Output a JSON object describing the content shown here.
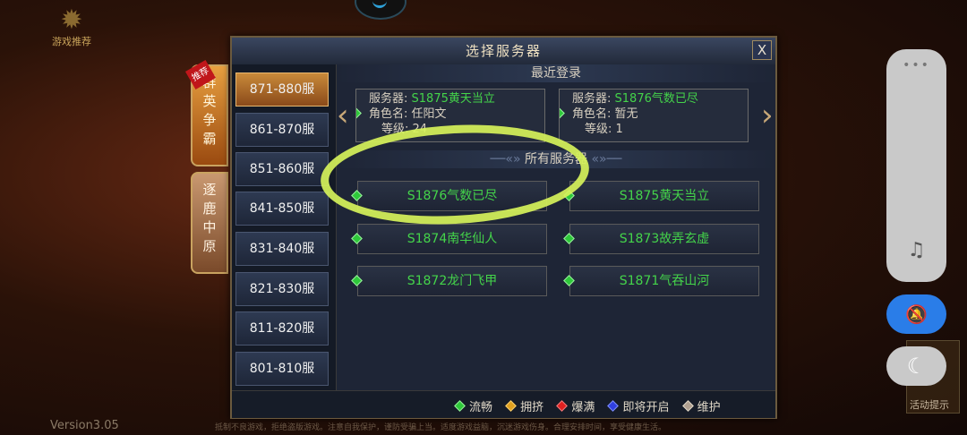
{
  "app": {
    "logo_text": "游戏推荐",
    "version": "Version3.05",
    "bottom_tip": "抵制不良游戏，拒绝盗版游戏。注意自我保护，谨防受骗上当。适度游戏益脑，沉迷游戏伤身。合理安排时间，享受健康生活。"
  },
  "dialog": {
    "title": "选择服务器",
    "close_label": "X",
    "recent_title": "最近登录",
    "all_title": "所有服务器"
  },
  "tabs": [
    {
      "label": "群英争霸",
      "badge": "推荐",
      "active": true
    },
    {
      "label": "逐鹿中原",
      "active": false
    }
  ],
  "ranges": [
    {
      "label": "871-880服",
      "active": true
    },
    {
      "label": "861-870服"
    },
    {
      "label": "851-860服"
    },
    {
      "label": "841-850服"
    },
    {
      "label": "831-840服"
    },
    {
      "label": "821-830服"
    },
    {
      "label": "811-820服"
    },
    {
      "label": "801-810服"
    }
  ],
  "recent": [
    {
      "server_label": "服务器:",
      "server": "S1875黄天当立",
      "role_label": "角色名:",
      "role": "任阳文",
      "level_label": "等级:",
      "level": "24"
    },
    {
      "server_label": "服务器:",
      "server": "S1876气数已尽",
      "role_label": "角色名:",
      "role": "暂无",
      "level_label": "等级:",
      "level": "1"
    }
  ],
  "servers": [
    {
      "name": "S1876气数已尽",
      "status": "流畅"
    },
    {
      "name": "S1875黄天当立",
      "status": "流畅"
    },
    {
      "name": "S1874南华仙人",
      "status": "流畅"
    },
    {
      "name": "S1873故弄玄虚",
      "status": "流畅"
    },
    {
      "name": "S1872龙门飞甲",
      "status": "流畅"
    },
    {
      "name": "S1871气吞山河",
      "status": "流畅"
    }
  ],
  "legend": [
    {
      "label": "流畅",
      "color": "#2ec83a"
    },
    {
      "label": "拥挤",
      "color": "#e0a020"
    },
    {
      "label": "爆满",
      "color": "#e02020"
    },
    {
      "label": "即将开启",
      "color": "#3040e0"
    },
    {
      "label": "维护",
      "color": "#b0a090"
    }
  ],
  "right_tip": {
    "label": "活动提示"
  },
  "overlay": {
    "dots": "•••",
    "music_icon": "music-off-icon",
    "mute_icon": "bell-off-icon",
    "moon_icon": "moon-icon"
  }
}
